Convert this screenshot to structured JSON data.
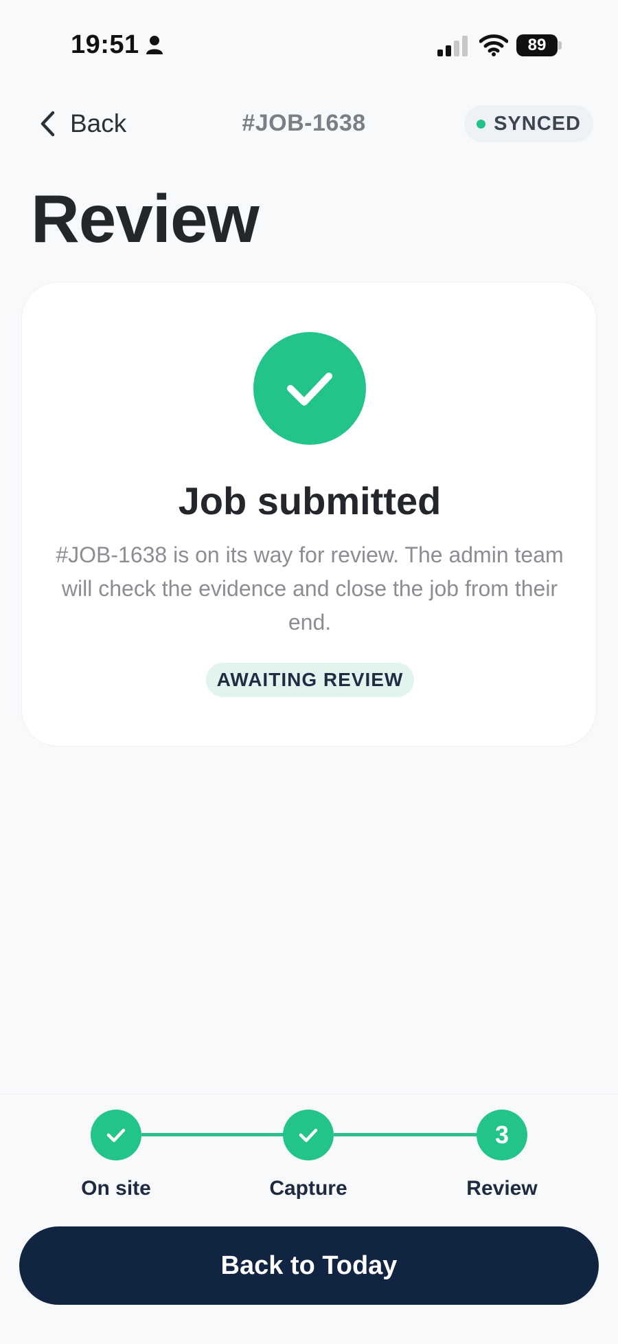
{
  "status_bar": {
    "time": "19:51",
    "battery": "89"
  },
  "header": {
    "back_label": "Back",
    "job_id": "#JOB-1638",
    "sync_status": "SYNCED"
  },
  "page": {
    "title": "Review"
  },
  "card": {
    "title": "Job submitted",
    "description": "#JOB-1638 is on its way for review. The admin team will check the evidence and close the job from their end.",
    "status_pill": "AWAITING REVIEW"
  },
  "steps": [
    {
      "label": "On site",
      "state": "complete"
    },
    {
      "label": "Capture",
      "state": "complete"
    },
    {
      "label": "Review",
      "number": "3",
      "state": "current"
    }
  ],
  "footer": {
    "primary_button": "Back to Today"
  },
  "colors": {
    "accent_green": "#23c48a",
    "navy": "#112543",
    "background": "#f8f9fb"
  }
}
